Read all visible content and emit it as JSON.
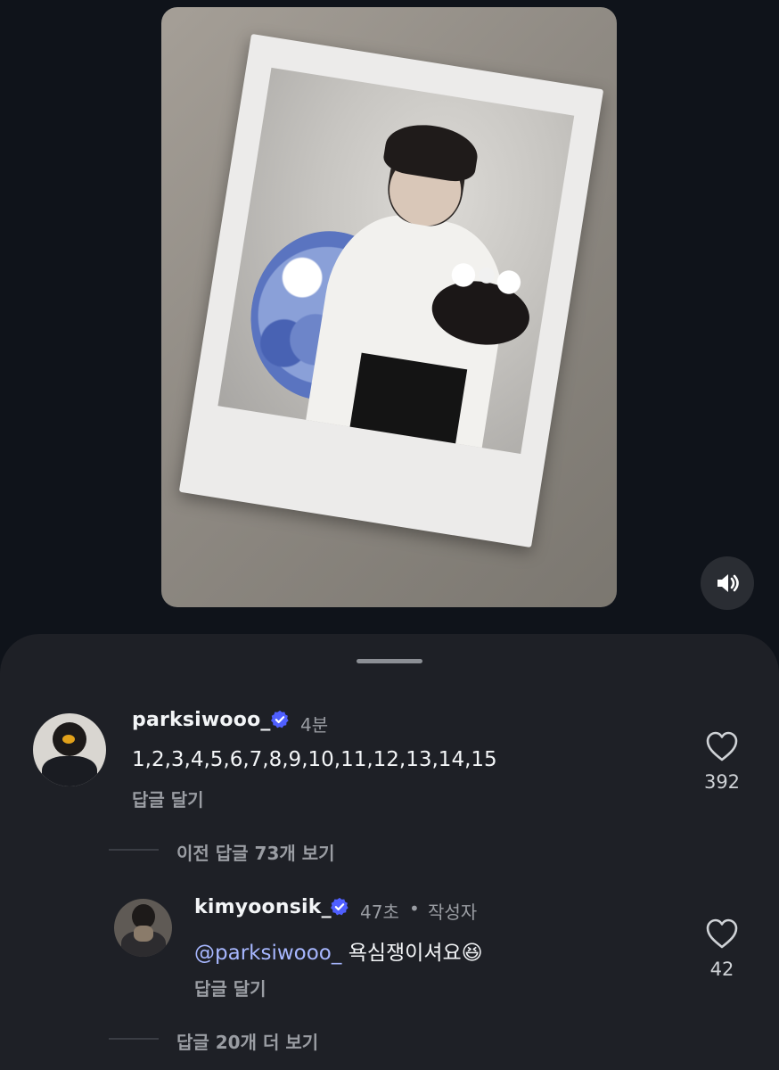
{
  "media": {
    "sound_icon": "speaker-icon"
  },
  "comments": [
    {
      "username": "parksiwooo_",
      "time": "4분",
      "text": "1,2,3,4,5,6,7,8,9,10,11,12,13,14,15",
      "reply_label": "답글 달기",
      "likes": "392",
      "verified_color": "#4f5fff"
    }
  ],
  "view_previous": "이전 답글 73개 보기",
  "reply": {
    "username": "kimyoonsik_",
    "time": "47초",
    "separator": "•",
    "author_tag": "작성자",
    "mention": "@parksiwooo_",
    "text": "욕심쟁이셔요😆",
    "reply_label": "답글 달기",
    "likes": "42"
  },
  "view_more": "답글 20개 더 보기",
  "colors": {
    "background": "#0f131a",
    "sheet": "#1e2026",
    "mention": "#a7b7ff",
    "verified": "#4f5fff"
  }
}
